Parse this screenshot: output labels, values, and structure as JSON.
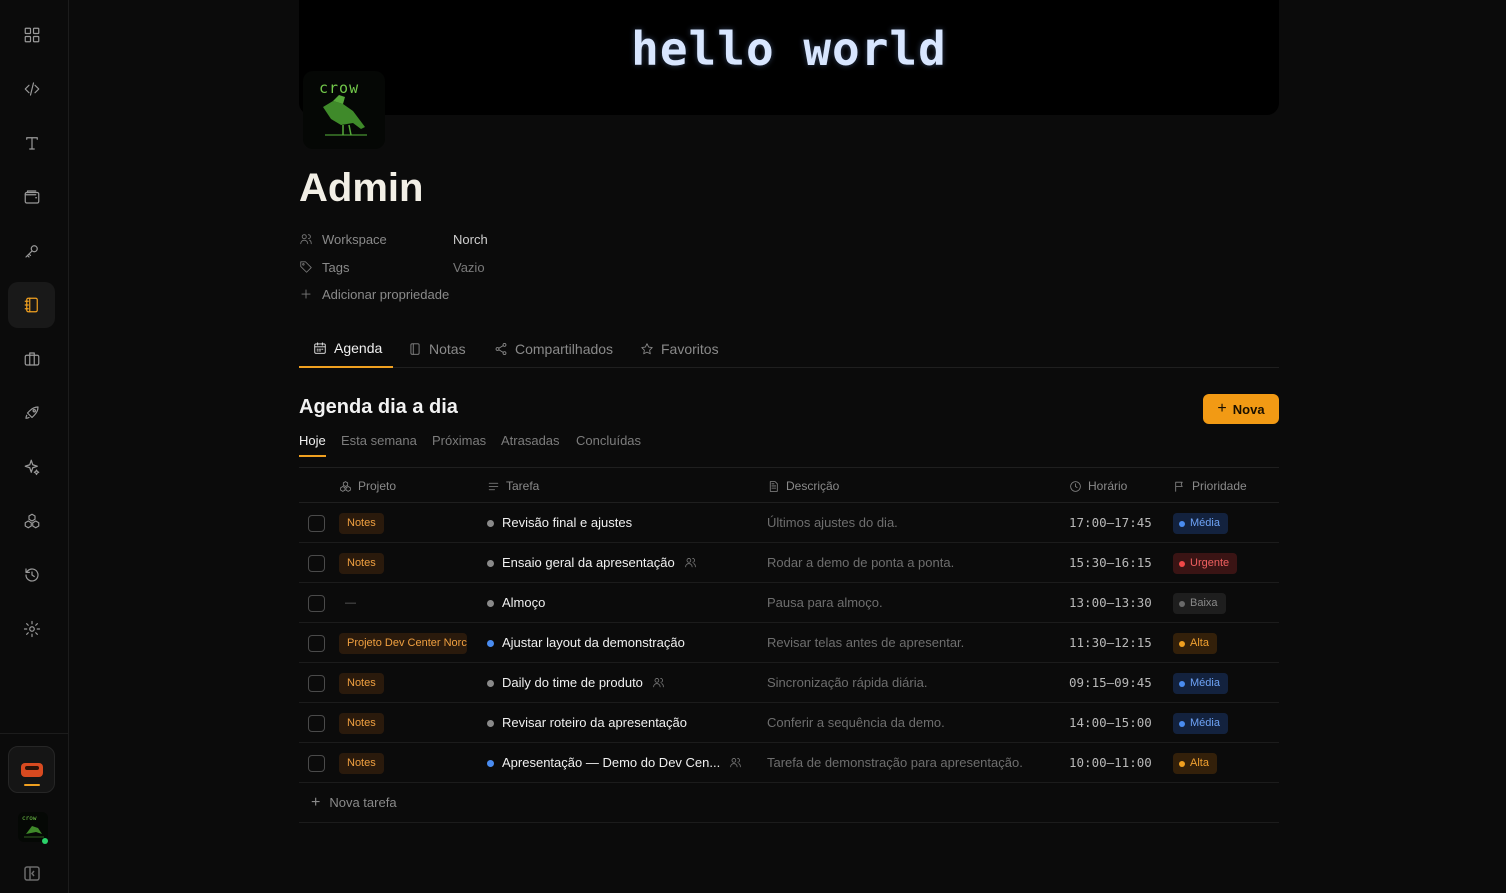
{
  "sidebar": {
    "items": [
      {
        "icon": "grid-icon"
      },
      {
        "icon": "code-icon"
      },
      {
        "icon": "text-icon"
      },
      {
        "icon": "wallet-icon"
      },
      {
        "icon": "key-icon"
      },
      {
        "icon": "notebook-icon",
        "active": true
      },
      {
        "icon": "briefcase-icon"
      },
      {
        "icon": "rocket-icon"
      },
      {
        "icon": "sparkles-icon"
      },
      {
        "icon": "apps-icon"
      },
      {
        "icon": "history-icon"
      },
      {
        "icon": "settings-icon"
      }
    ],
    "accent": "#f0a020"
  },
  "cover": {
    "text": "hello world"
  },
  "logo": {
    "text": "crow"
  },
  "page": {
    "title": "Admin"
  },
  "properties": [
    {
      "label": "Workspace",
      "value": "Norch"
    },
    {
      "label": "Tags",
      "value": "Vazio"
    }
  ],
  "add_property": "Adicionar propriedade",
  "tabs": [
    {
      "label": "Agenda",
      "icon": "calendar-icon",
      "active": true
    },
    {
      "label": "Notas",
      "icon": "notebook-icon"
    },
    {
      "label": "Compartilhados",
      "icon": "share-icon"
    },
    {
      "label": "Favoritos",
      "icon": "star-icon"
    }
  ],
  "section": {
    "title": "Agenda dia a dia",
    "new_button": "Nova"
  },
  "subtabs": [
    {
      "label": "Hoje",
      "active": true
    },
    {
      "label": "Esta semana"
    },
    {
      "label": "Próximas"
    },
    {
      "label": "Atrasadas"
    },
    {
      "label": "Concluídas"
    }
  ],
  "table": {
    "headers": {
      "project": "Projeto",
      "task": "Tarefa",
      "description": "Descrição",
      "time": "Horário",
      "priority": "Prioridade"
    },
    "rows": [
      {
        "project": "Notes",
        "task": "Revisão final e ajustes",
        "shared": false,
        "dot": "gray",
        "description": "Últimos ajustes do dia.",
        "time": "17:00–17:45",
        "priority": "Média",
        "prio_class": "media"
      },
      {
        "project": "Notes",
        "task": "Ensaio geral da apresentação",
        "shared": true,
        "dot": "gray",
        "description": "Rodar a demo de ponta a ponta.",
        "time": "15:30–16:15",
        "priority": "Urgente",
        "prio_class": "urgente"
      },
      {
        "project": "—",
        "task": "Almoço",
        "shared": false,
        "dot": "gray",
        "description": "Pausa para almoço.",
        "time": "13:00–13:30",
        "priority": "Baixa",
        "prio_class": "baixa"
      },
      {
        "project": "Projeto Dev Center Norch",
        "task": "Ajustar layout da demonstração",
        "shared": false,
        "dot": "blue",
        "description": "Revisar telas antes de apresentar.",
        "time": "11:30–12:15",
        "priority": "Alta",
        "prio_class": "alta"
      },
      {
        "project": "Notes",
        "task": "Daily do time de produto",
        "shared": true,
        "dot": "gray",
        "description": "Sincronização rápida diária.",
        "time": "09:15–09:45",
        "priority": "Média",
        "prio_class": "media"
      },
      {
        "project": "Notes",
        "task": "Revisar roteiro da apresentação",
        "shared": false,
        "dot": "gray",
        "description": "Conferir a sequência da demo.",
        "time": "14:00–15:00",
        "priority": "Média",
        "prio_class": "media"
      },
      {
        "project": "Notes",
        "task": "Apresentação — Demo do Dev Cen...",
        "shared": true,
        "dot": "blue",
        "description": "Tarefa de demonstração para apresentação.",
        "time": "10:00–11:00",
        "priority": "Alta",
        "prio_class": "alta"
      }
    ],
    "new_task": "Nova tarefa"
  }
}
